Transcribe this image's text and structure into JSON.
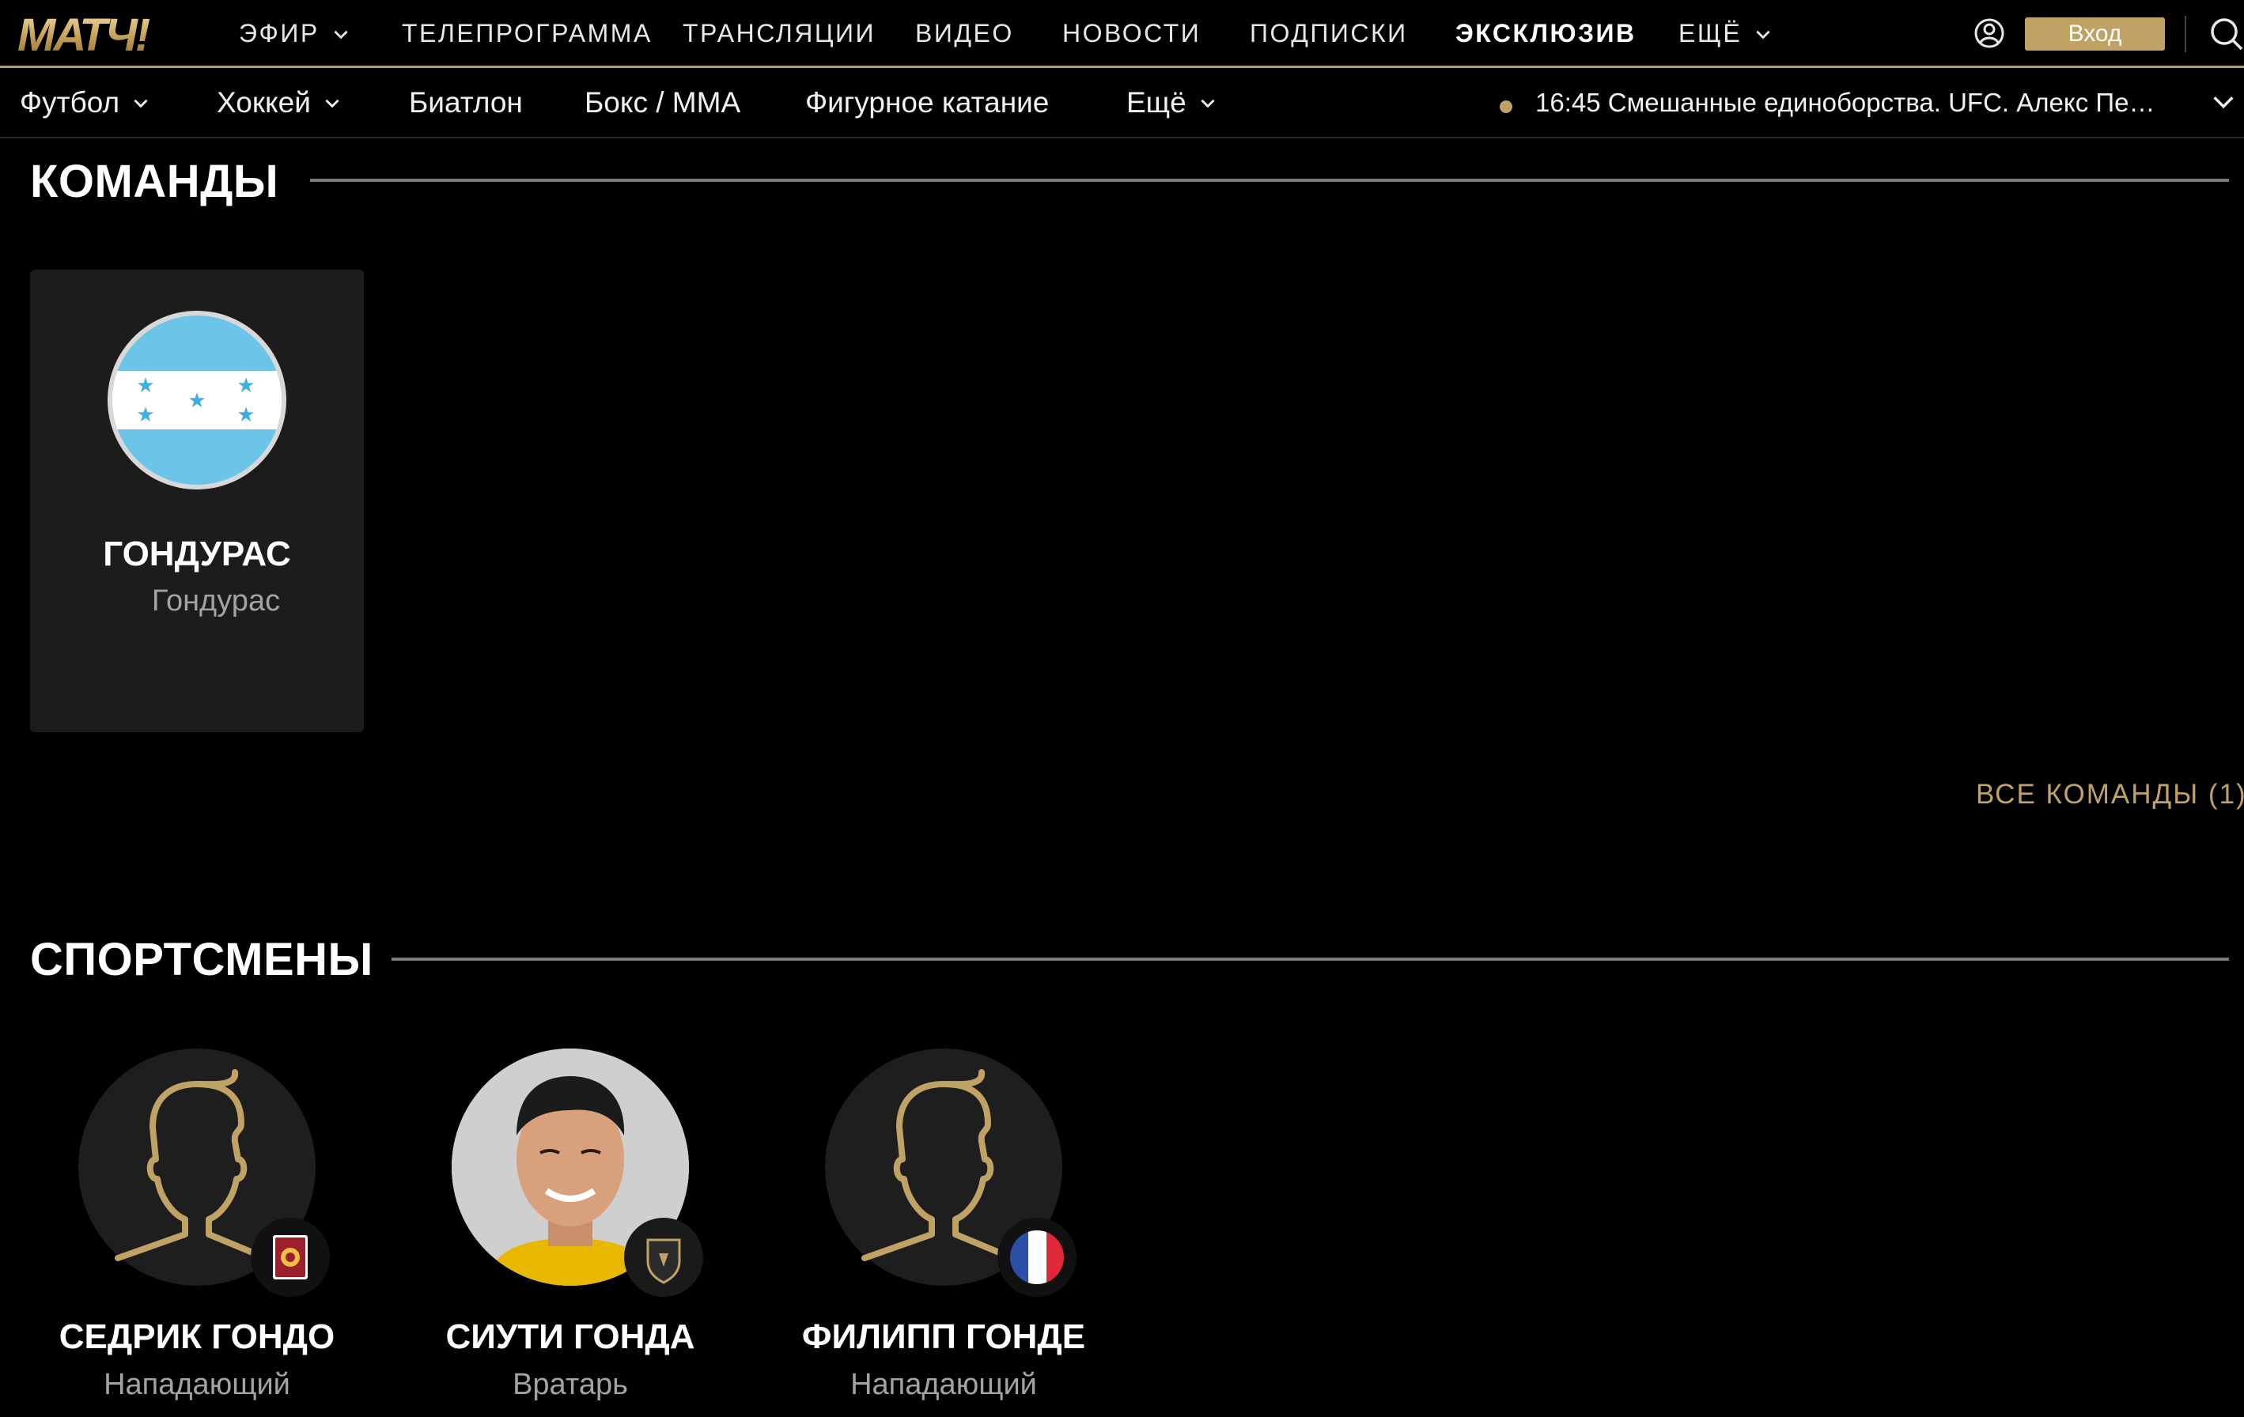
{
  "brand": {
    "logo_text": "МАТЧ!",
    "accent_color": "#c1a265"
  },
  "topnav": {
    "items": [
      {
        "label": "ЭФИР",
        "dropdown": true
      },
      {
        "label": "ТЕЛЕПРОГРАММА",
        "dropdown": false
      },
      {
        "label": "ТРАНСЛЯЦИИ",
        "dropdown": false
      },
      {
        "label": "ВИДЕО",
        "dropdown": false
      },
      {
        "label": "НОВОСТИ",
        "dropdown": false
      },
      {
        "label": "ПОДПИСКИ",
        "dropdown": false
      },
      {
        "label": "ЭКСКЛЮЗИВ",
        "dropdown": false
      },
      {
        "label": "ЕЩЁ",
        "dropdown": true
      }
    ],
    "login_label": "Вход"
  },
  "subnav": {
    "items": [
      {
        "label": "Футбол",
        "dropdown": true
      },
      {
        "label": "Хоккей",
        "dropdown": true
      },
      {
        "label": "Биатлон",
        "dropdown": false
      },
      {
        "label": "Бокс / ММА",
        "dropdown": false
      },
      {
        "label": "Фигурное катание",
        "dropdown": false
      },
      {
        "label": "Ещё",
        "dropdown": true
      }
    ],
    "live": "16:45 Смешанные единоборства. UFC. Алекс Пере..."
  },
  "teams_section": {
    "title": "КОМАНДЫ",
    "teams": [
      {
        "name": "ГОНДУРАС",
        "country": "Гондурас",
        "flag": "honduras-flag"
      }
    ],
    "all_link": "ВСЕ КОМАНДЫ (1)"
  },
  "athletes_section": {
    "title": "СПОРТСМЕНЫ",
    "athletes": [
      {
        "name": "СЕДРИК ГОНДО",
        "position": "Нападающий",
        "avatar": "placeholder-silhouette",
        "club": "reggiana-crest"
      },
      {
        "name": "СИУТИ ГОНДА",
        "position": "Вратарь",
        "avatar": "player-photo",
        "club": "club-crest-dark"
      },
      {
        "name": "ФИЛИПП ГОНДЕ",
        "position": "Нападающий",
        "avatar": "placeholder-silhouette",
        "club": "france-flag"
      }
    ]
  }
}
